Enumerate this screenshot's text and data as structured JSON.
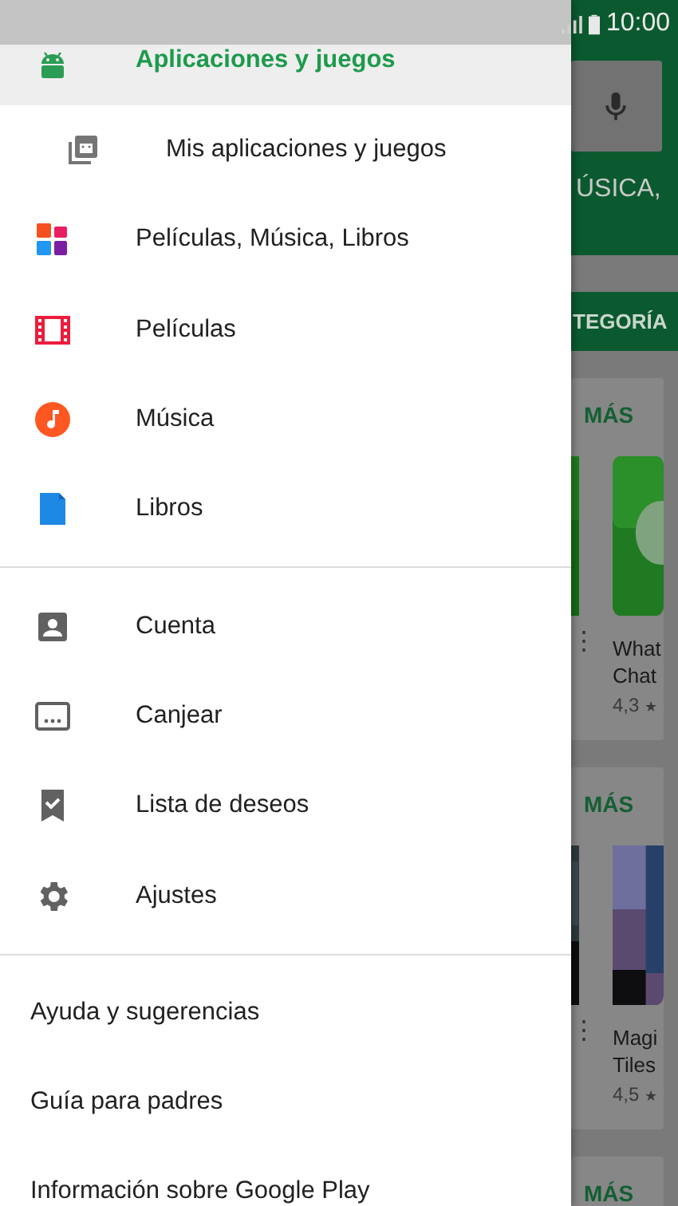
{
  "status_bar": {
    "time": "10:00"
  },
  "drawer": {
    "sections": [
      [
        {
          "label": "Aplicaciones y juegos",
          "kind": "main",
          "selected": true
        },
        {
          "label": "Mis aplicaciones y juegos",
          "kind": "sub",
          "selected": false
        },
        {
          "label": "Películas, Música, Libros",
          "kind": "main",
          "selected": false
        },
        {
          "label": "Películas",
          "kind": "main",
          "selected": false
        },
        {
          "label": "Música",
          "kind": "main",
          "selected": false
        },
        {
          "label": "Libros",
          "kind": "main",
          "selected": false
        }
      ],
      [
        {
          "label": "Cuenta",
          "kind": "main",
          "selected": false
        },
        {
          "label": "Canjear",
          "kind": "main",
          "selected": false
        },
        {
          "label": "Lista de deseos",
          "kind": "main",
          "selected": false
        },
        {
          "label": "Ajustes",
          "kind": "main",
          "selected": false
        }
      ]
    ],
    "links": [
      "Ayuda y sugerencias",
      "Guía para padres",
      "Información sobre Google Play"
    ]
  },
  "background": {
    "search_text": "ÚSICA,",
    "tab": "TEGORÍA",
    "cards": [
      {
        "more": "MÁS",
        "menu": "⋮",
        "app_name": [
          "What",
          "Chat"
        ],
        "rating": "4,3",
        "star": "★"
      },
      {
        "more": "MÁS",
        "menu": "⋮",
        "app_name": [
          "Magi",
          "Tiles"
        ],
        "rating": "4,5",
        "star": "★"
      },
      {
        "more": "MÁS"
      }
    ]
  }
}
